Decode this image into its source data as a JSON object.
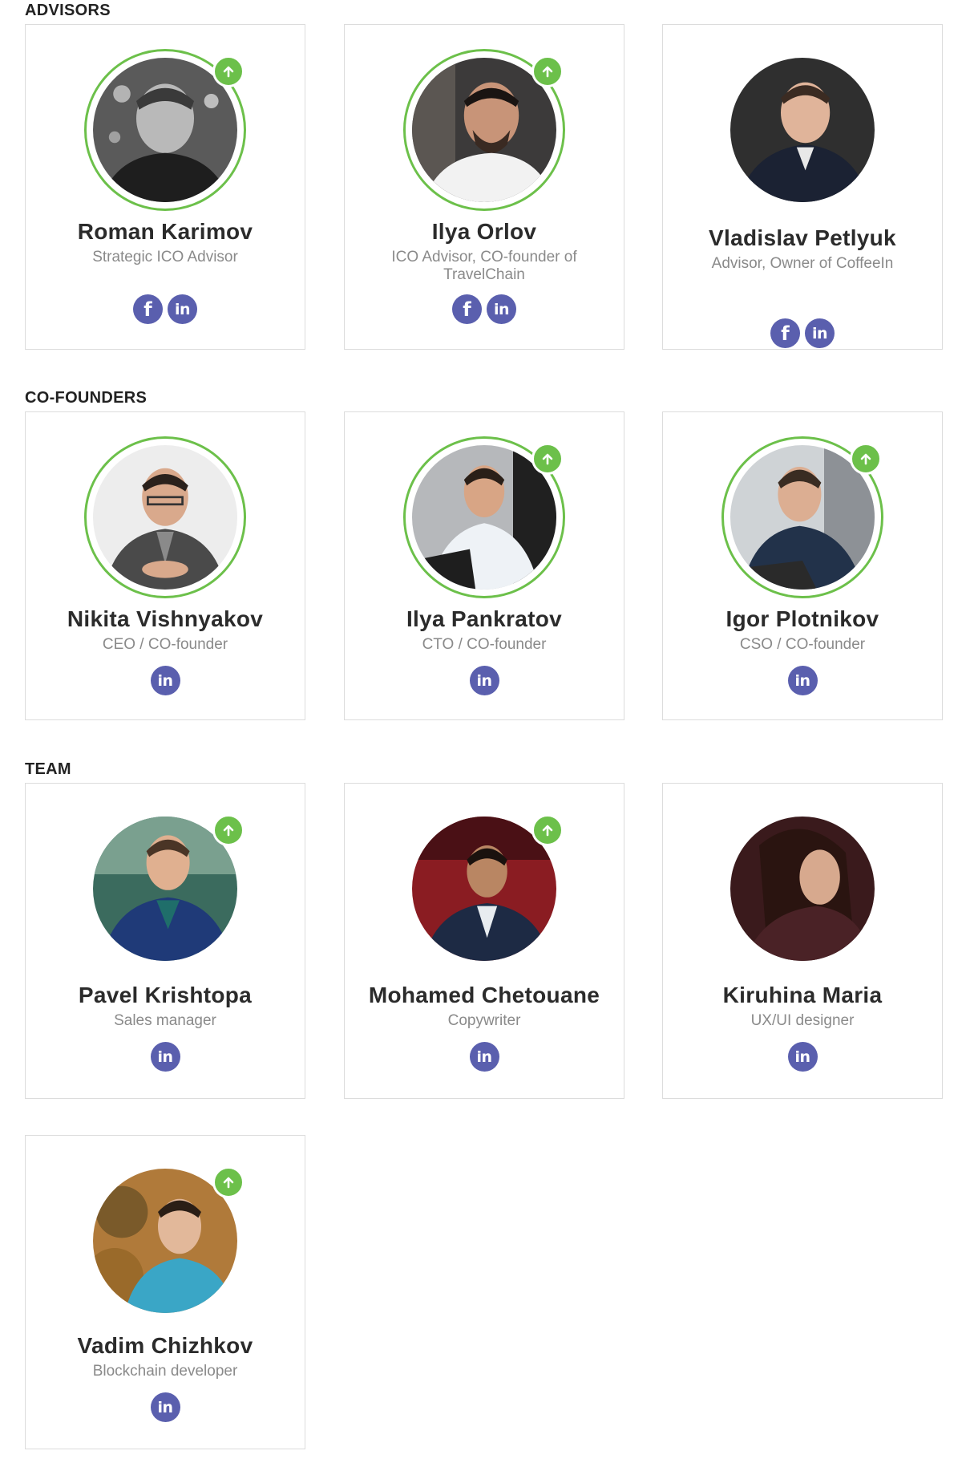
{
  "sections": {
    "advisors": "ADVISORS",
    "cofounders": "CO-FOUNDERS",
    "team": "TEAM"
  },
  "colors": {
    "accent_green": "#6cc04a",
    "social_purple": "#5a5fae",
    "border": "#dcdcdc"
  },
  "icons": {
    "badge": "arrow-up-icon",
    "facebook": "facebook-icon",
    "linkedin": "linkedin-icon"
  },
  "social_labels": {
    "facebook": "f",
    "linkedin": "in"
  },
  "advisors": [
    {
      "name": "Roman Karimov",
      "role": "Strategic ICO Advisor"
    },
    {
      "name": "Ilya Orlov",
      "role": "ICO Advisor, CO-founder of TravelChain"
    },
    {
      "name": "Vladislav Petlyuk",
      "role": "Advisor, Owner of CoffeeIn"
    }
  ],
  "cofounders": [
    {
      "name": "Nikita Vishnyakov",
      "role": "CEO / CO-founder"
    },
    {
      "name": "Ilya Pankratov",
      "role": "CTO / CO-founder"
    },
    {
      "name": "Igor Plotnikov",
      "role": "CSO / CO-founder"
    }
  ],
  "team": [
    {
      "name": "Pavel Krishtopa",
      "role": "Sales manager"
    },
    {
      "name": "Mohamed Chetouane",
      "role": "Copywriter"
    },
    {
      "name": "Kiruhina Maria",
      "role": "UX/UI designer"
    },
    {
      "name": "Vadim Chizhkov",
      "role": "Blockchain developer"
    }
  ]
}
